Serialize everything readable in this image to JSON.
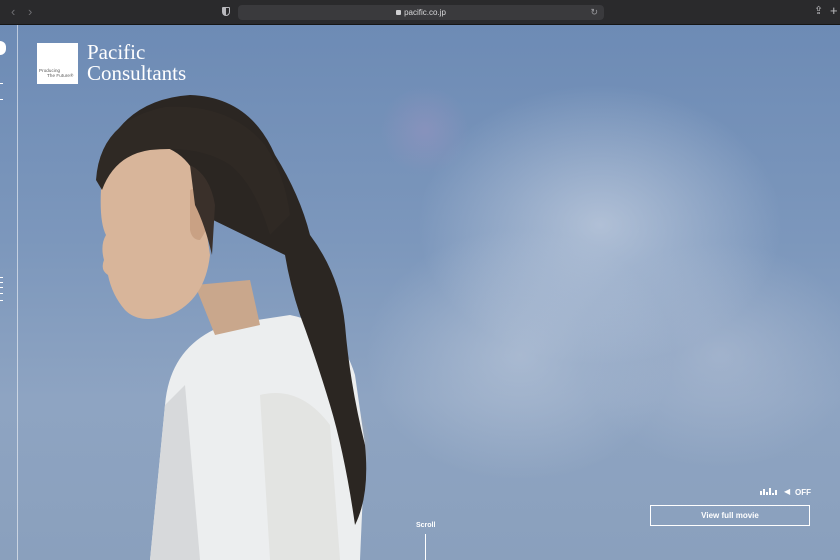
{
  "browser": {
    "url": "pacific.co.jp",
    "back_icon": "‹",
    "forward_icon": "›",
    "reload_icon": "↻",
    "share_icon": "⇪",
    "newtab_icon": "+"
  },
  "brand": {
    "name_line1": "Pacific",
    "name_line2": "Consultants",
    "tagline_line1": "Producing",
    "tagline_line2": "The Future®"
  },
  "hero": {
    "sound_label": "OFF",
    "view_movie_label": "View full movie",
    "scroll_label": "Scroll"
  },
  "colors": {
    "sky": "#7c97bc",
    "chrome": "#2a2a2c",
    "text": "#ffffff"
  }
}
